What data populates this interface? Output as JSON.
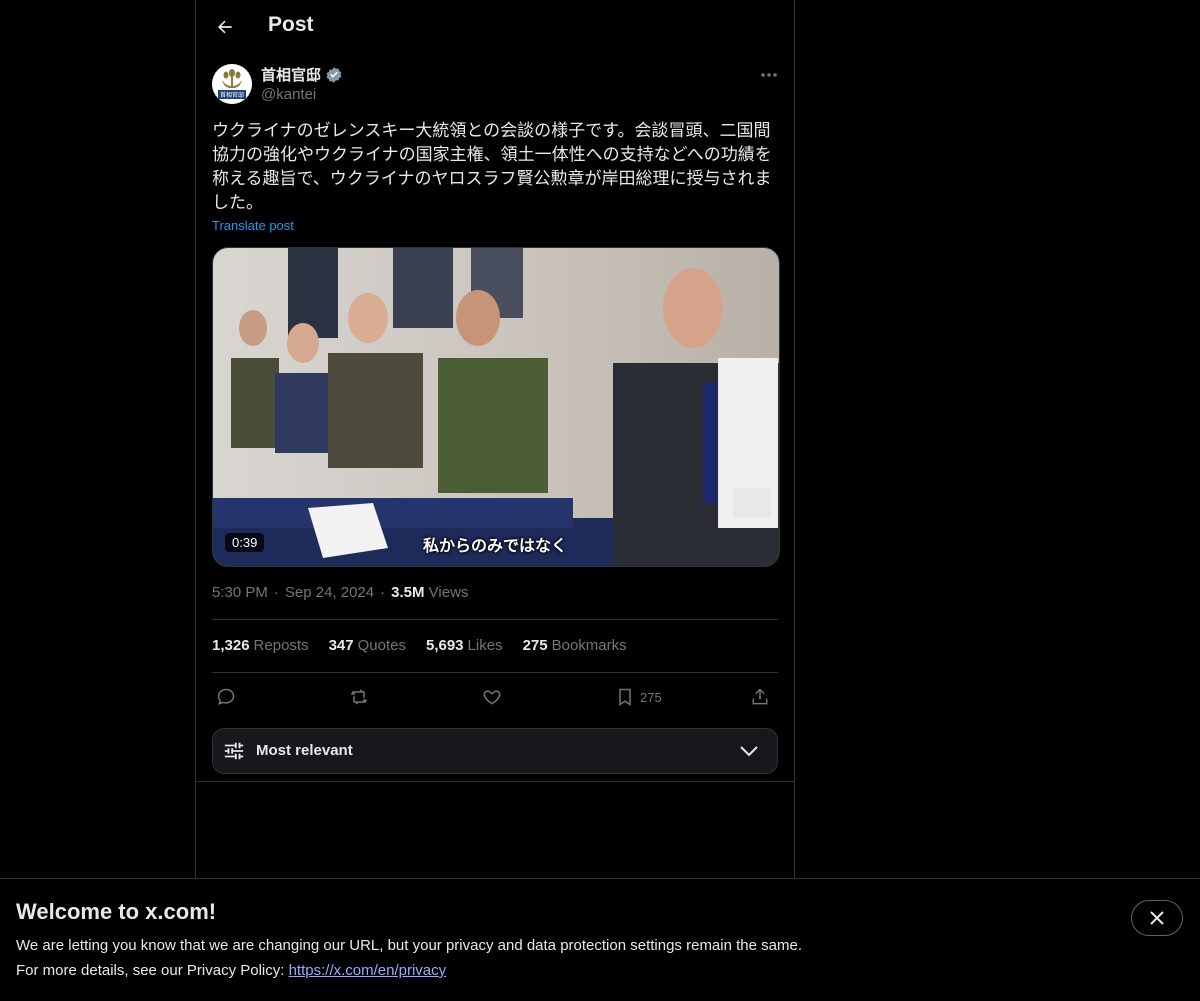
{
  "topbar": {
    "title": "Post",
    "back_icon": "arrow-left-icon"
  },
  "author": {
    "name": "首相官邸",
    "handle": "@kantei",
    "verified_color": "#829aab",
    "avatar_text": "首相官邸"
  },
  "post": {
    "text": "ウクライナのゼレンスキー大統領との会談の様子です。会談冒頭、二国間協力の強化やウクライナの国家主権、領土一体性への支持などへの功績を称える趣旨で、ウクライナのヤロスラフ賢公勲章が岸田総理に授与されました。",
    "translate_label": "Translate post"
  },
  "media": {
    "duration": "0:39",
    "subtitle": "私からのみではなく"
  },
  "meta": {
    "time": "5:30 PM",
    "date": "Sep 24, 2024",
    "views_count": "3.5M",
    "views_label": "Views",
    "separator": "·"
  },
  "stats": [
    {
      "num": "1,326",
      "label": "Reposts"
    },
    {
      "num": "347",
      "label": "Quotes"
    },
    {
      "num": "5,693",
      "label": "Likes"
    },
    {
      "num": "275",
      "label": "Bookmarks"
    }
  ],
  "actions": {
    "reply_icon": "reply-icon",
    "repost_icon": "repost-icon",
    "like_icon": "heart-icon",
    "bookmark_icon": "bookmark-icon",
    "bookmark_count": "275",
    "share_icon": "share-icon"
  },
  "sort": {
    "label": "Most relevant"
  },
  "banner": {
    "title": "Welcome to x.com!",
    "line1": "We are letting you know that we are changing our URL, but your privacy and data protection settings remain the same.",
    "line2_prefix": "For more details, see our Privacy Policy: ",
    "link": "https://x.com/en/privacy"
  },
  "colors": {
    "background": "#000000",
    "accent": "#1d9bf0",
    "muted": "#71767b",
    "border": "#2f3336"
  }
}
